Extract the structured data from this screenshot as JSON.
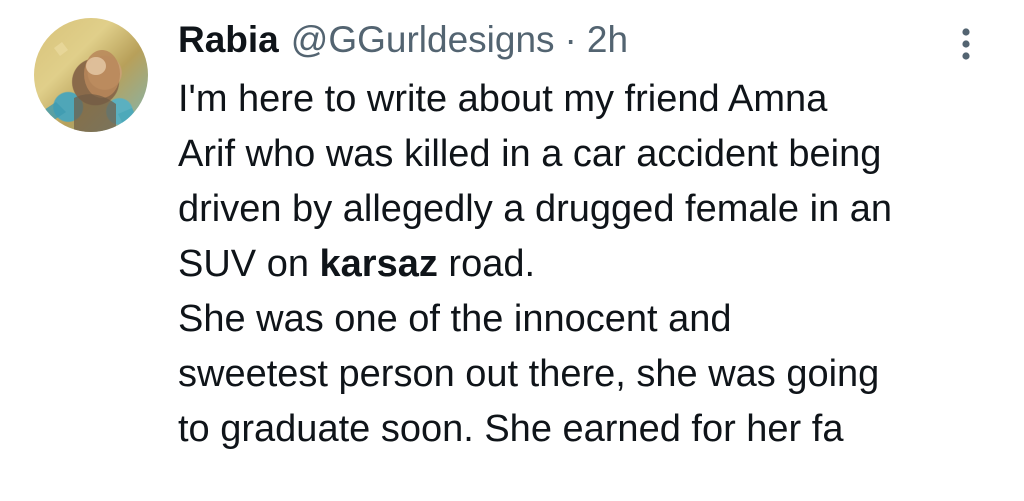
{
  "author": {
    "display_name": "Rabia",
    "handle": "@GGurldesigns",
    "separator": "·",
    "time": "2h"
  },
  "icons": {
    "avatar": "profile-photo",
    "more": "more-options-vertical-icon"
  },
  "tweet": {
    "lines": [
      {
        "parts": [
          {
            "text": "I'm here to write about my friend Amna",
            "bold": false
          }
        ]
      },
      {
        "parts": [
          {
            "text": "Arif who was killed in a car accident being",
            "bold": false
          }
        ]
      },
      {
        "parts": [
          {
            "text": "driven by allegedly a drugged female in an",
            "bold": false
          }
        ]
      },
      {
        "parts": [
          {
            "text": "SUV on ",
            "bold": false
          },
          {
            "text": "karsaz",
            "bold": true
          },
          {
            "text": " road.",
            "bold": false
          }
        ]
      },
      {
        "parts": [
          {
            "text": "She was one of the innocent and",
            "bold": false
          }
        ]
      },
      {
        "parts": [
          {
            "text": "sweetest person out there, she was going",
            "bold": false
          }
        ]
      },
      {
        "parts": [
          {
            "text": "to graduate soon. She earned for her fa",
            "bold": false
          }
        ]
      }
    ]
  },
  "colors": {
    "text_primary": "#0f1419",
    "text_secondary": "#536471",
    "background": "#ffffff"
  }
}
